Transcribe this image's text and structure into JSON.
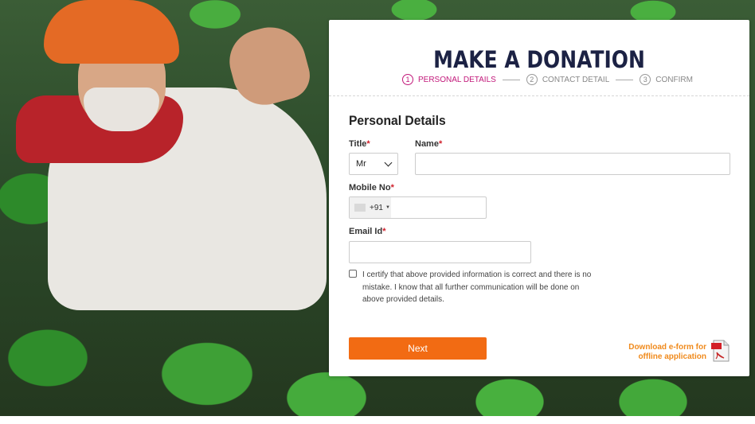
{
  "donation": {
    "title": "MAKE A DONATION",
    "steps": [
      {
        "number": "1",
        "label": "PERSONAL DETAILS",
        "active": true
      },
      {
        "number": "2",
        "label": "CONTACT DETAIL",
        "active": false
      },
      {
        "number": "3",
        "label": "CONFIRM",
        "active": false
      }
    ],
    "section_title": "Personal Details",
    "fields": {
      "title_label": "Title",
      "title_value": "Mr",
      "name_label": "Name",
      "name_value": "",
      "mobile_label": "Mobile No",
      "dial_code": "+91",
      "mobile_value": "",
      "email_label": "Email Id",
      "email_value": "",
      "required_mark": "*"
    },
    "certify_text": "I certify that above provided information is correct and there is no mistake. I know that all further communication will be done on above provided details.",
    "next_label": "Next",
    "download_line1": "Download e-form for",
    "download_line2": "offline application"
  },
  "colors": {
    "accent": "#f26b13",
    "step_active": "#c2187a",
    "title": "#1c2244",
    "download_link": "#f08a1c",
    "required": "#d0202b"
  },
  "icons": [
    "chevron-down-icon",
    "pdf-icon"
  ]
}
